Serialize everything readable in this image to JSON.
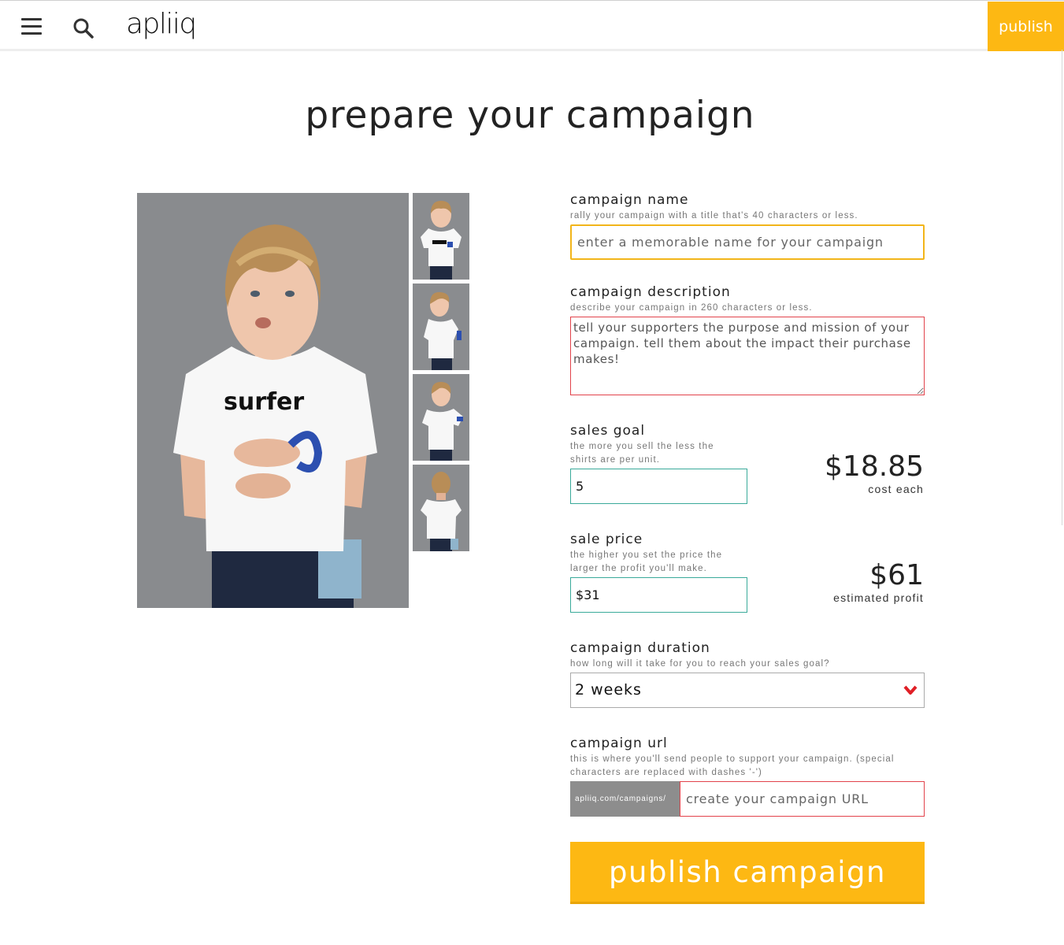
{
  "header": {
    "logo_text": "apliiq",
    "publish_label": "publish"
  },
  "page": {
    "title": "prepare your campaign"
  },
  "product": {
    "shirt_text": "surfer"
  },
  "form": {
    "campaign_name": {
      "label": "campaign name",
      "hint": "rally your campaign with a title that's 40 characters or less.",
      "placeholder": "enter a memorable name for your campaign",
      "value": ""
    },
    "campaign_description": {
      "label": "campaign description",
      "hint": "describe your campaign in 260 characters or less.",
      "placeholder": "tell your supporters the purpose and mission of your campaign. tell them about the impact their purchase makes!",
      "value": ""
    },
    "sales_goal": {
      "label": "sales goal",
      "hint_line1": "the more you sell the less the",
      "hint_line2": "shirts are per unit.",
      "value": "5",
      "cost_value": "$18.85",
      "cost_caption": "cost each"
    },
    "sale_price": {
      "label": "sale price",
      "hint_line1": "the higher you set the price the",
      "hint_line2": "larger the profit you'll make.",
      "value": "$31",
      "profit_value": "$61",
      "profit_caption": "estimated profit"
    },
    "campaign_duration": {
      "label": "campaign duration",
      "hint": "how long will it take for you to reach your sales goal?",
      "selected": "2 weeks"
    },
    "campaign_url": {
      "label": "campaign url",
      "hint_line1": "this is where you'll send people to support your campaign. (special",
      "hint_line2": "characters are replaced with dashes '-')",
      "prefix": "apliiq.com/campaigns/",
      "placeholder": "create your campaign URL",
      "value": ""
    },
    "submit_label": "publish campaign"
  },
  "colors": {
    "accent": "#fdb813",
    "error_border": "#e2434b",
    "valid_border": "#3aaa9a",
    "photo_background": "#8a8c8f"
  },
  "icons": {
    "menu": "hamburger-menu-icon",
    "search": "search-icon",
    "select_arrow": "chevron-down-icon"
  }
}
